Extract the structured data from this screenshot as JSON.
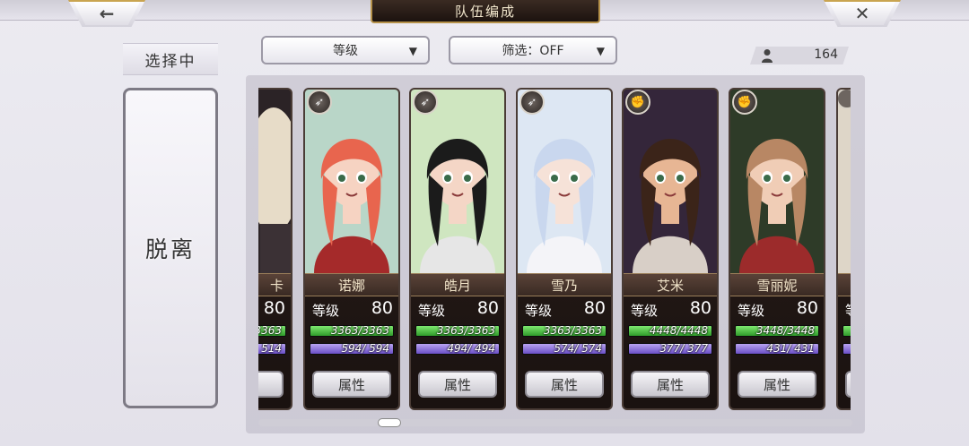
{
  "header": {
    "title": "队伍编成",
    "back_icon": "←",
    "close_icon": "✕"
  },
  "toolbar": {
    "sort": {
      "value": "等级",
      "caret": "▼"
    },
    "filter": {
      "value": "筛选：OFF",
      "caret": "▼"
    },
    "unit_count": "164"
  },
  "sidebar": {
    "selecting_label": "选择中",
    "detach_label": "脱离"
  },
  "common": {
    "level_label": "等级",
    "attr_button_label": "属性"
  },
  "partial_left": {
    "name_fragment": "卡",
    "level": "80",
    "hp_fragment": "3363",
    "sp_fragment": "514"
  },
  "partial_right": {
    "level_label_fragment": "等"
  },
  "characters": [
    {
      "name": "诺娜",
      "class_icon": "bow-icon",
      "level": "80",
      "hp": "3363/3363",
      "hp_ratio": 1.0,
      "sp": "594/ 594",
      "sp_ratio": 1.0,
      "palette": {
        "bg": "#b9d6c8",
        "hair": "#e8654e",
        "skin": "#f6d3c2",
        "cloth": "#a52a2a"
      }
    },
    {
      "name": "皓月",
      "class_icon": "bow-icon",
      "level": "80",
      "hp": "3363/3363",
      "hp_ratio": 1.0,
      "sp": "494/ 494",
      "sp_ratio": 1.0,
      "palette": {
        "bg": "#cfe6c0",
        "hair": "#1b1b1b",
        "skin": "#f4d6c6",
        "cloth": "#e6e6e6"
      }
    },
    {
      "name": "雪乃",
      "class_icon": "bow-icon",
      "level": "80",
      "hp": "3363/3363",
      "hp_ratio": 1.0,
      "sp": "574/ 574",
      "sp_ratio": 1.0,
      "palette": {
        "bg": "#dde7f3",
        "hair": "#c9d7ee",
        "skin": "#f6e2d8",
        "cloth": "#f4f4f8"
      }
    },
    {
      "name": "艾米",
      "class_icon": "fist-icon",
      "level": "80",
      "hp": "4448/4448",
      "hp_ratio": 1.0,
      "sp": "377/ 377",
      "sp_ratio": 1.0,
      "palette": {
        "bg": "#34263a",
        "hair": "#3b2419",
        "skin": "#e7b694",
        "cloth": "#d8cfc7"
      }
    },
    {
      "name": "雪丽妮",
      "class_icon": "fist-icon",
      "level": "80",
      "hp": "3448/3448",
      "hp_ratio": 1.0,
      "sp": "431/ 431",
      "sp_ratio": 1.0,
      "palette": {
        "bg": "#2e3b28",
        "hair": "#b88764",
        "skin": "#f0cdb6",
        "cloth": "#9c2b2b"
      }
    }
  ],
  "colors": {
    "accent_gold": "#c9a450",
    "hp_green": "#3cb33a",
    "sp_purple": "#7d5fd6"
  }
}
